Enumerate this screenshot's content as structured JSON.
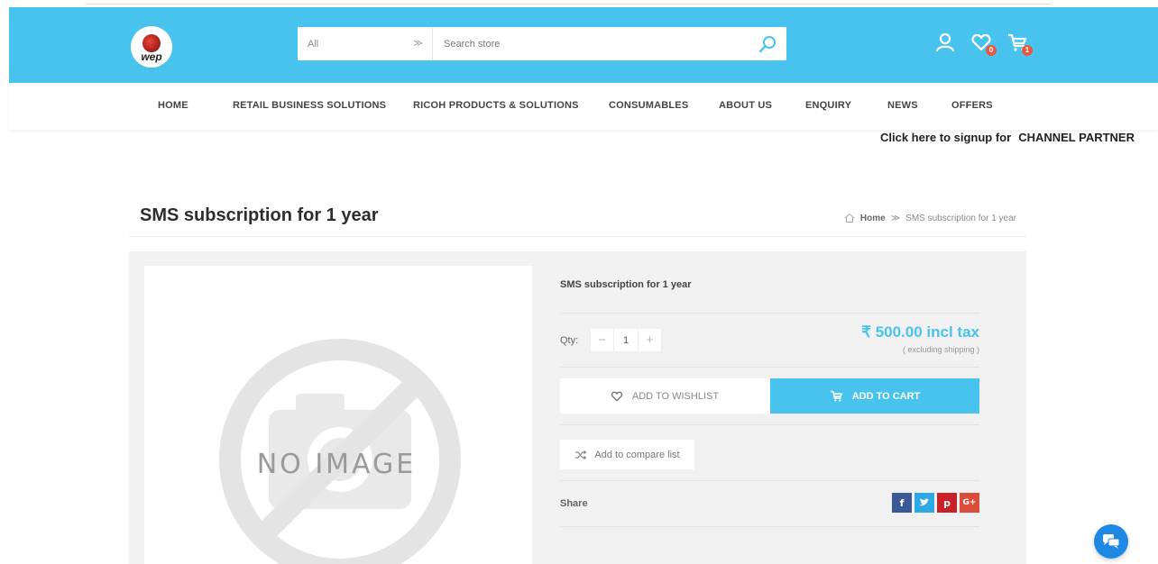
{
  "header": {
    "logo_text": "wep",
    "search": {
      "category": "All",
      "placeholder": "Search store"
    },
    "icons": {
      "account": "user-icon",
      "wishlist": "heart-icon",
      "wishlist_count": "0",
      "cart": "cart-icon",
      "cart_count": "1"
    },
    "accent_color": "#47c3ee"
  },
  "nav": {
    "items": [
      "HOME",
      "RETAIL BUSINESS SOLUTIONS",
      "RICOH PRODUCTS & SOLUTIONS",
      "CONSUMABLES",
      "ABOUT US",
      "ENQUIRY",
      "NEWS",
      "OFFERS"
    ]
  },
  "signup": {
    "text": "Click here to signup for",
    "partner": "CHANNEL PARTNER"
  },
  "page": {
    "title": "SMS subscription for 1 year",
    "breadcrumb": {
      "home": "Home",
      "current": "SMS subscription for 1 year"
    }
  },
  "product": {
    "image_placeholder": "NO IMAGE",
    "name": "SMS subscription for 1 year",
    "qty_label": "Qty:",
    "qty_value": "1",
    "price": "₹ 500.00 incl tax",
    "price_note": "( excluding shipping )",
    "wishlist_label": "ADD TO WISHLIST",
    "cart_label": "ADD TO CART",
    "compare_label": "Add to compare list",
    "share_label": "Share",
    "share_networks": [
      {
        "name": "facebook",
        "glyph": "f",
        "color": "#3b5998"
      },
      {
        "name": "twitter",
        "glyph": "t",
        "color": "#2fa8e6"
      },
      {
        "name": "pinterest",
        "glyph": "p",
        "color": "#cb2027"
      },
      {
        "name": "google-plus",
        "glyph": "G+",
        "color": "#dd4b39"
      }
    ]
  },
  "chat": {
    "icon": "chat-icon",
    "color": "#1e88e5"
  }
}
